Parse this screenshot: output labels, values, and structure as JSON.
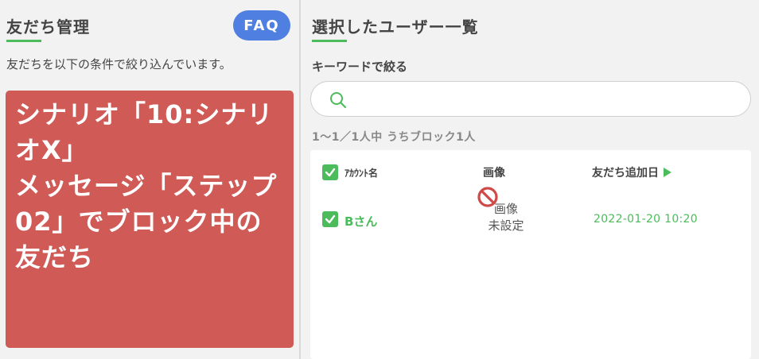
{
  "left": {
    "title": "友だち管理",
    "faq_label": "FAQ",
    "description": "友だちを以下の条件で絞り込んでいます。",
    "filter_text": "シナリオ「10:シナリオX」\nメッセージ「ステップ02」でブロック中の友だち"
  },
  "right": {
    "title": "選択したユーザー一覧",
    "keyword_label": "キーワードで絞る",
    "search_placeholder": "",
    "count_text": "1〜1／1人中 うちブロック1人",
    "table": {
      "headers": {
        "account": "ｱｶｳﾝﾄ名",
        "image": "画像",
        "added": "友だち追加日"
      },
      "rows": [
        {
          "name": "Bさん",
          "image_line1": "画像",
          "image_line2": "未設定",
          "added_date": "2022-01-20 10:20"
        }
      ]
    }
  },
  "colors": {
    "accent_green": "#4cbb5c",
    "faq_blue": "#4f7fe0",
    "filter_red": "#cf5a56"
  },
  "icons": {
    "search": "search-icon",
    "checkbox": "checkbox-checked-icon",
    "no_image": "no-image-icon",
    "sort": "sort-arrow-icon"
  }
}
